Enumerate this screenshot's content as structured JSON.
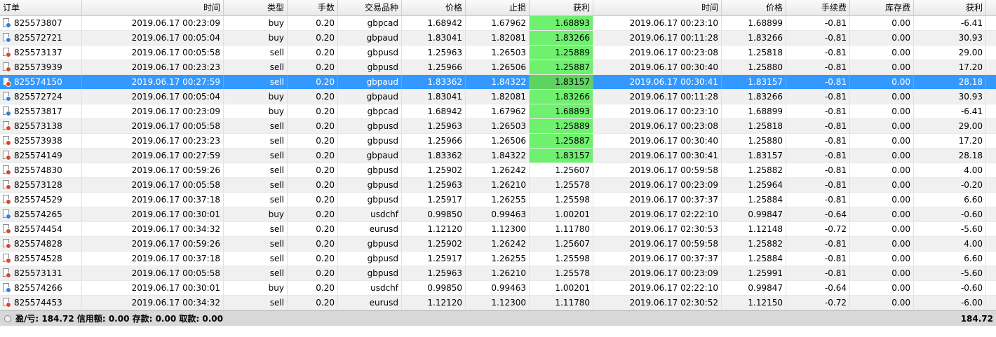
{
  "headers": [
    "订单",
    "时间",
    "类型",
    "手数",
    "交易品种",
    "价格",
    "止损",
    "获利",
    "时间",
    "价格",
    "手续费",
    "库存费",
    "获利"
  ],
  "rows": [
    {
      "order": "825573807",
      "open_time": "2019.06.17 00:23:09",
      "type": "buy",
      "lots": "0.20",
      "symbol": "gbpcad",
      "open_price": "1.68942",
      "sl": "1.67962",
      "tp": "1.68893",
      "close_time": "2019.06.17 00:23:10",
      "close_price": "1.68899",
      "commission": "-0.81",
      "swap": "0.00",
      "profit": "-6.41",
      "tp_hit": true
    },
    {
      "order": "825572721",
      "open_time": "2019.06.17 00:05:04",
      "type": "buy",
      "lots": "0.20",
      "symbol": "gbpaud",
      "open_price": "1.83041",
      "sl": "1.82081",
      "tp": "1.83266",
      "close_time": "2019.06.17 00:11:28",
      "close_price": "1.83266",
      "commission": "-0.81",
      "swap": "0.00",
      "profit": "30.93",
      "tp_hit": true
    },
    {
      "order": "825573137",
      "open_time": "2019.06.17 00:05:58",
      "type": "sell",
      "lots": "0.20",
      "symbol": "gbpusd",
      "open_price": "1.25963",
      "sl": "1.26503",
      "tp": "1.25889",
      "close_time": "2019.06.17 00:23:08",
      "close_price": "1.25818",
      "commission": "-0.81",
      "swap": "0.00",
      "profit": "29.00",
      "tp_hit": true
    },
    {
      "order": "825573939",
      "open_time": "2019.06.17 00:23:23",
      "type": "sell",
      "lots": "0.20",
      "symbol": "gbpusd",
      "open_price": "1.25966",
      "sl": "1.26506",
      "tp": "1.25887",
      "close_time": "2019.06.17 00:30:40",
      "close_price": "1.25880",
      "commission": "-0.81",
      "swap": "0.00",
      "profit": "17.20",
      "tp_hit": true
    },
    {
      "order": "825574150",
      "open_time": "2019.06.17 00:27:59",
      "type": "sell",
      "lots": "0.20",
      "symbol": "gbpaud",
      "open_price": "1.83362",
      "sl": "1.84322",
      "tp": "1.83157",
      "close_time": "2019.06.17 00:30:41",
      "close_price": "1.83157",
      "commission": "-0.81",
      "swap": "0.00",
      "profit": "28.18",
      "tp_hit": true,
      "selected": true
    },
    {
      "order": "825572724",
      "open_time": "2019.06.17 00:05:04",
      "type": "buy",
      "lots": "0.20",
      "symbol": "gbpaud",
      "open_price": "1.83041",
      "sl": "1.82081",
      "tp": "1.83266",
      "close_time": "2019.06.17 00:11:28",
      "close_price": "1.83266",
      "commission": "-0.81",
      "swap": "0.00",
      "profit": "30.93",
      "tp_hit": true
    },
    {
      "order": "825573817",
      "open_time": "2019.06.17 00:23:09",
      "type": "buy",
      "lots": "0.20",
      "symbol": "gbpcad",
      "open_price": "1.68942",
      "sl": "1.67962",
      "tp": "1.68893",
      "close_time": "2019.06.17 00:23:10",
      "close_price": "1.68899",
      "commission": "-0.81",
      "swap": "0.00",
      "profit": "-6.41",
      "tp_hit": true
    },
    {
      "order": "825573138",
      "open_time": "2019.06.17 00:05:58",
      "type": "sell",
      "lots": "0.20",
      "symbol": "gbpusd",
      "open_price": "1.25963",
      "sl": "1.26503",
      "tp": "1.25889",
      "close_time": "2019.06.17 00:23:08",
      "close_price": "1.25818",
      "commission": "-0.81",
      "swap": "0.00",
      "profit": "29.00",
      "tp_hit": true
    },
    {
      "order": "825573938",
      "open_time": "2019.06.17 00:23:23",
      "type": "sell",
      "lots": "0.20",
      "symbol": "gbpusd",
      "open_price": "1.25966",
      "sl": "1.26506",
      "tp": "1.25887",
      "close_time": "2019.06.17 00:30:40",
      "close_price": "1.25880",
      "commission": "-0.81",
      "swap": "0.00",
      "profit": "17.20",
      "tp_hit": true
    },
    {
      "order": "825574149",
      "open_time": "2019.06.17 00:27:59",
      "type": "sell",
      "lots": "0.20",
      "symbol": "gbpaud",
      "open_price": "1.83362",
      "sl": "1.84322",
      "tp": "1.83157",
      "close_time": "2019.06.17 00:30:41",
      "close_price": "1.83157",
      "commission": "-0.81",
      "swap": "0.00",
      "profit": "28.18",
      "tp_hit": true
    },
    {
      "order": "825574830",
      "open_time": "2019.06.17 00:59:26",
      "type": "sell",
      "lots": "0.20",
      "symbol": "gbpusd",
      "open_price": "1.25902",
      "sl": "1.26242",
      "tp": "1.25607",
      "close_time": "2019.06.17 00:59:58",
      "close_price": "1.25882",
      "commission": "-0.81",
      "swap": "0.00",
      "profit": "4.00",
      "tp_hit": false
    },
    {
      "order": "825573128",
      "open_time": "2019.06.17 00:05:58",
      "type": "sell",
      "lots": "0.20",
      "symbol": "gbpusd",
      "open_price": "1.25963",
      "sl": "1.26210",
      "tp": "1.25578",
      "close_time": "2019.06.17 00:23:09",
      "close_price": "1.25964",
      "commission": "-0.81",
      "swap": "0.00",
      "profit": "-0.20",
      "tp_hit": false
    },
    {
      "order": "825574529",
      "open_time": "2019.06.17 00:37:18",
      "type": "sell",
      "lots": "0.20",
      "symbol": "gbpusd",
      "open_price": "1.25917",
      "sl": "1.26255",
      "tp": "1.25598",
      "close_time": "2019.06.17 00:37:37",
      "close_price": "1.25884",
      "commission": "-0.81",
      "swap": "0.00",
      "profit": "6.60",
      "tp_hit": false
    },
    {
      "order": "825574265",
      "open_time": "2019.06.17 00:30:01",
      "type": "buy",
      "lots": "0.20",
      "symbol": "usdchf",
      "open_price": "0.99850",
      "sl": "0.99463",
      "tp": "1.00201",
      "close_time": "2019.06.17 02:22:10",
      "close_price": "0.99847",
      "commission": "-0.64",
      "swap": "0.00",
      "profit": "-0.60",
      "tp_hit": false
    },
    {
      "order": "825574454",
      "open_time": "2019.06.17 00:34:32",
      "type": "sell",
      "lots": "0.20",
      "symbol": "eurusd",
      "open_price": "1.12120",
      "sl": "1.12300",
      "tp": "1.11780",
      "close_time": "2019.06.17 02:30:53",
      "close_price": "1.12148",
      "commission": "-0.72",
      "swap": "0.00",
      "profit": "-5.60",
      "tp_hit": false
    },
    {
      "order": "825574828",
      "open_time": "2019.06.17 00:59:26",
      "type": "sell",
      "lots": "0.20",
      "symbol": "gbpusd",
      "open_price": "1.25902",
      "sl": "1.26242",
      "tp": "1.25607",
      "close_time": "2019.06.17 00:59:58",
      "close_price": "1.25882",
      "commission": "-0.81",
      "swap": "0.00",
      "profit": "4.00",
      "tp_hit": false
    },
    {
      "order": "825574528",
      "open_time": "2019.06.17 00:37:18",
      "type": "sell",
      "lots": "0.20",
      "symbol": "gbpusd",
      "open_price": "1.25917",
      "sl": "1.26255",
      "tp": "1.25598",
      "close_time": "2019.06.17 00:37:37",
      "close_price": "1.25884",
      "commission": "-0.81",
      "swap": "0.00",
      "profit": "6.60",
      "tp_hit": false
    },
    {
      "order": "825573131",
      "open_time": "2019.06.17 00:05:58",
      "type": "sell",
      "lots": "0.20",
      "symbol": "gbpusd",
      "open_price": "1.25963",
      "sl": "1.26210",
      "tp": "1.25578",
      "close_time": "2019.06.17 00:23:09",
      "close_price": "1.25991",
      "commission": "-0.81",
      "swap": "0.00",
      "profit": "-5.60",
      "tp_hit": false
    },
    {
      "order": "825574266",
      "open_time": "2019.06.17 00:30:01",
      "type": "buy",
      "lots": "0.20",
      "symbol": "usdchf",
      "open_price": "0.99850",
      "sl": "0.99463",
      "tp": "1.00201",
      "close_time": "2019.06.17 02:22:10",
      "close_price": "0.99847",
      "commission": "-0.64",
      "swap": "0.00",
      "profit": "-0.60",
      "tp_hit": false
    },
    {
      "order": "825574453",
      "open_time": "2019.06.17 00:34:32",
      "type": "sell",
      "lots": "0.20",
      "symbol": "eurusd",
      "open_price": "1.12120",
      "sl": "1.12300",
      "tp": "1.11780",
      "close_time": "2019.06.17 02:30:52",
      "close_price": "1.12150",
      "commission": "-0.72",
      "swap": "0.00",
      "profit": "-6.00",
      "tp_hit": false
    }
  ],
  "footer": {
    "summary": "盈/亏: 184.72  信用额: 0.00  存款: 0.00  取款: 0.00",
    "total": "184.72"
  },
  "colors": {
    "buy_icon": "#2f7fd8",
    "sell_icon": "#d9472b",
    "tp_highlight": "#6ff06f",
    "selected_row": "#3399ff"
  },
  "icons": {
    "buy": "buy-order-icon",
    "sell": "sell-order-icon"
  }
}
